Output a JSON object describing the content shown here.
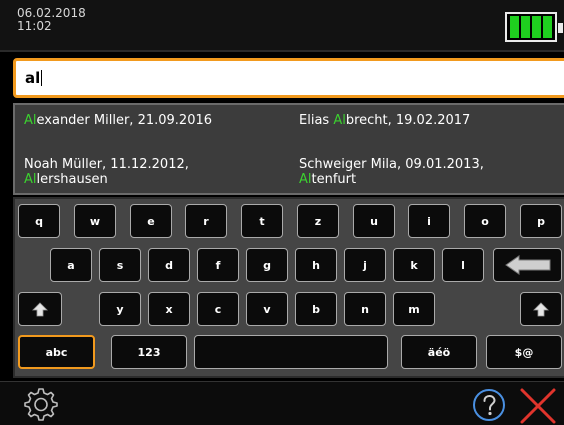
{
  "status": {
    "date": "06.02.2018",
    "time": "11:02",
    "battery_icon": "battery-full-icon",
    "battery_color": "#1fd01f"
  },
  "search": {
    "value": "al"
  },
  "suggestions": [
    {
      "hl": "Al",
      "rest": "exander Miller, 21.09.2016",
      "pre": ""
    },
    {
      "pre": "Elias ",
      "hl": "Al",
      "rest": "brecht, 19.02.2017"
    },
    {
      "line1": "Noah Müller, 11.12.2012,",
      "hl": "Al",
      "rest": "lershausen"
    },
    {
      "line1": "Schweiger Mila, 09.01.2013,",
      "hl": "Al",
      "rest": "tenfurt"
    }
  ],
  "keyboard": {
    "row1": [
      "q",
      "w",
      "e",
      "r",
      "t",
      "z",
      "u",
      "i",
      "o",
      "p"
    ],
    "row2": [
      "a",
      "s",
      "d",
      "f",
      "g",
      "h",
      "j",
      "k",
      "l"
    ],
    "row3": [
      "y",
      "x",
      "c",
      "v",
      "b",
      "n",
      "m"
    ],
    "row4": {
      "abc": "abc",
      "num": "123",
      "accents": "äéö",
      "symbols": "$@"
    },
    "backspace_icon": "backspace-arrow-icon",
    "shift_icon": "shift-arrow-icon"
  },
  "colors": {
    "accent": "#f29a1e",
    "highlight": "#3bd12f",
    "close": "#e0342c",
    "help": "#4a90e2"
  },
  "bottom": {
    "settings_icon": "gear-icon",
    "help_icon": "help-icon",
    "close_icon": "close-icon"
  }
}
